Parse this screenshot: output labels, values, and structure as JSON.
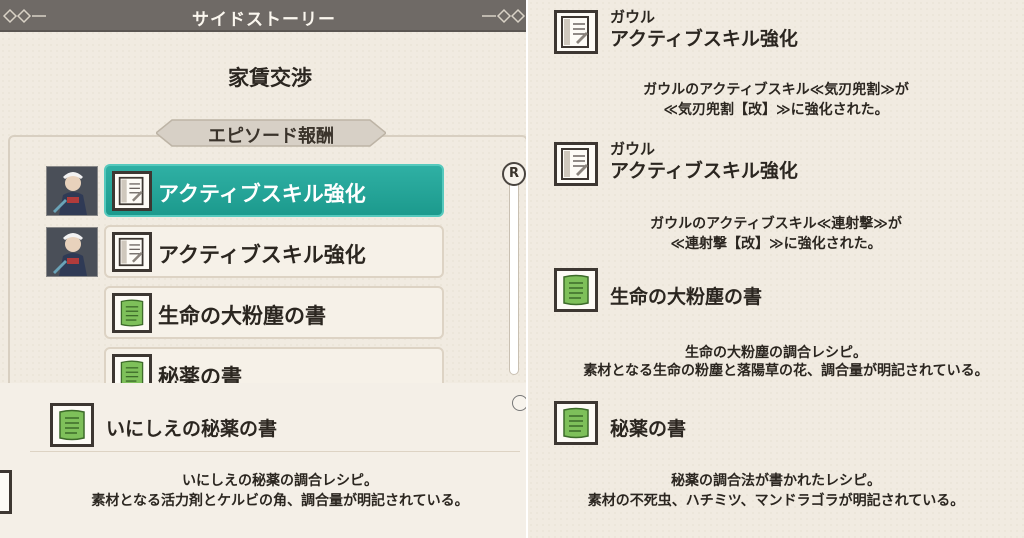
{
  "left_panel": {
    "header_title": "サイドストーリー",
    "story_title": "家賃交渉",
    "reward_section_label": "エピソード報酬",
    "rewards": [
      {
        "label": "アクティブスキル強化",
        "icon": "skill-scroll-icon",
        "selected": true,
        "has_avatar": true
      },
      {
        "label": "アクティブスキル強化",
        "icon": "skill-scroll-icon",
        "selected": false,
        "has_avatar": true
      },
      {
        "label": "生命の大粉塵の書",
        "icon": "green-book-icon",
        "selected": false,
        "has_avatar": false
      },
      {
        "label": "秘薬の書",
        "icon": "green-book-icon",
        "selected": false,
        "has_avatar": false
      }
    ],
    "scroll_button_label": "R",
    "detail": {
      "name": "いにしえの秘薬の書",
      "icon": "green-book-icon",
      "desc_line1": "いにしえの秘薬の調合レシピ。",
      "desc_line2": "素材となる活力剤とケルビの角、調合量が明記されている。"
    }
  },
  "right_panel": {
    "items": [
      {
        "sub": "ガウル",
        "name": "アクティブスキル強化",
        "icon": "skill-scroll-icon",
        "desc_line1": "ガウルのアクティブスキル≪気刃兜割≫が",
        "desc_line2": "≪気刃兜割【改】≫に強化された。"
      },
      {
        "sub": "ガウル",
        "name": "アクティブスキル強化",
        "icon": "skill-scroll-icon",
        "desc_line1": "ガウルのアクティブスキル≪連射撃≫が",
        "desc_line2": "≪連射撃【改】≫に強化された。"
      },
      {
        "sub": "",
        "name": "生命の大粉塵の書",
        "icon": "green-book-icon",
        "desc_line1": "生命の大粉塵の調合レシピ。",
        "desc_line2": "素材となる生命の粉塵と落陽草の花、調合量が明記されている。"
      },
      {
        "sub": "",
        "name": "秘薬の書",
        "icon": "green-book-icon",
        "desc_line1": "秘薬の調合法が書かれたレシピ。",
        "desc_line2": "素材の不死虫、ハチミツ、マンドラゴラが明記されている。"
      }
    ]
  },
  "colors": {
    "selected_row": "#1fa295",
    "header_bar": "#6f6a66",
    "book_green": "#7ec05a",
    "background": "#f1ebe1"
  }
}
